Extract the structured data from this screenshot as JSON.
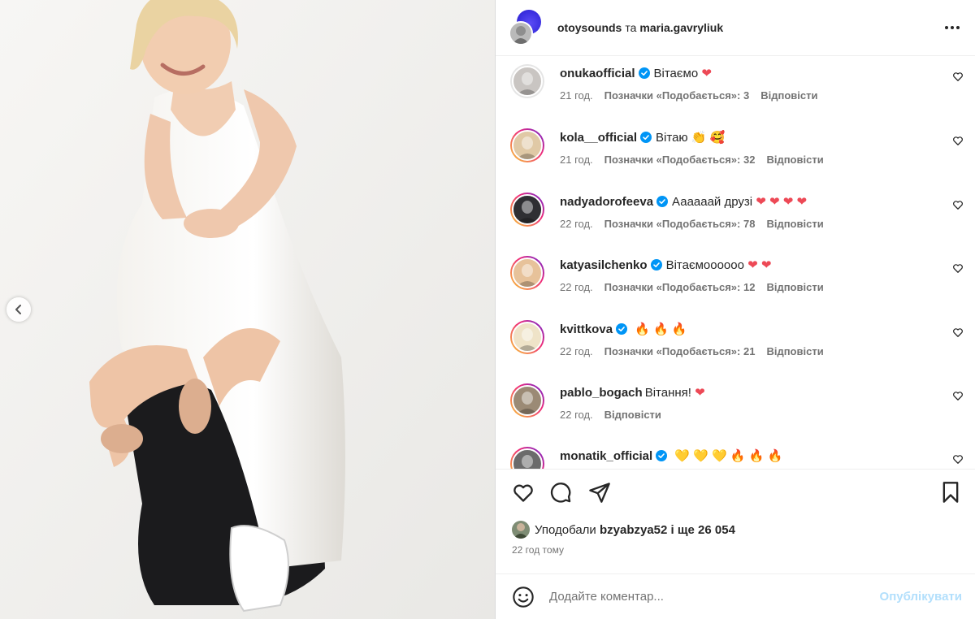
{
  "header": {
    "user1": "otoysounds",
    "separator": "та",
    "user2": "maria.gavryliuk"
  },
  "comments": [
    {
      "user": "onukaofficial",
      "text": "Вітаємо",
      "emoji": "❤",
      "time": "21 год.",
      "likes": "Позначки «Подобається»: 3",
      "reply": "Відповісти",
      "avatar_color": "#c9c5c2"
    },
    {
      "user": "kola__official",
      "text": "Вітаю",
      "emoji": "👏 🥰",
      "time": "21 год.",
      "likes": "Позначки «Подобається»: 32",
      "reply": "Відповісти",
      "avatar_color": "#e0c9a6"
    },
    {
      "user": "nadyadorofeeva",
      "text": "Аааааай друзі",
      "emoji": "❤ ❤ ❤ ❤",
      "time": "22 год.",
      "likes": "Позначки «Подобається»: 78",
      "reply": "Відповісти",
      "avatar_color": "#2f2f33"
    },
    {
      "user": "katyasilchenko",
      "text": "Вітаємоооооо",
      "emoji": "❤ ❤",
      "time": "22 год.",
      "likes": "Позначки «Подобається»: 12",
      "reply": "Відповісти",
      "avatar_color": "#e7c29a"
    },
    {
      "user": "kvittkova",
      "text": "",
      "emoji": "🔥 🔥 🔥",
      "time": "22 год.",
      "likes": "Позначки «Подобається»: 21",
      "reply": "Відповісти",
      "avatar_color": "#efe3c8"
    },
    {
      "user": "pablo_bogach",
      "text": "Вітання!",
      "emoji": "❤",
      "time": "22 год.",
      "likes": "",
      "reply": "Відповісти",
      "avatar_color": "#9b8a75"
    },
    {
      "user": "monatik_official",
      "text": "",
      "emoji": "💛 💛 💛 🔥 🔥 🔥",
      "time": "",
      "likes": "",
      "reply": "",
      "avatar_color": "#6b6b6b"
    }
  ],
  "liked_by": {
    "prefix": "Уподобали",
    "user": "bzyabzya52",
    "suffix": "і ще 26 054"
  },
  "time_ago": "22 год тому",
  "comment_box": {
    "placeholder": "Додайте коментар...",
    "post_label": "Опублікувати"
  },
  "colors": {
    "verified": "#0095f6",
    "heart": "#ed4956",
    "post_disabled": "#b2dffc"
  }
}
